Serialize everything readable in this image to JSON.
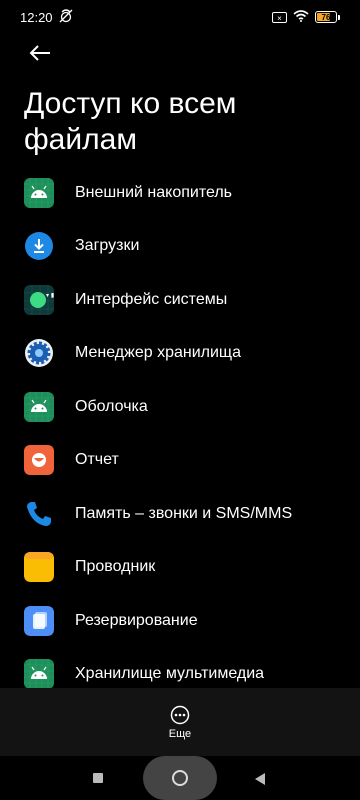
{
  "status_bar": {
    "time": "12:20",
    "battery_level": "76",
    "battery_fraction": 0.76,
    "battery_color": "#f5a623"
  },
  "page": {
    "title": "Доступ ко всем файлам"
  },
  "apps": [
    {
      "label": "Внешний накопитель",
      "icon": "android-icon"
    },
    {
      "label": "Загрузки",
      "icon": "download-icon"
    },
    {
      "label": "Интерфейс системы",
      "icon": "system-ui-icon"
    },
    {
      "label": "Менеджер хранилища",
      "icon": "storage-manager-icon"
    },
    {
      "label": "Оболочка",
      "icon": "android-icon"
    },
    {
      "label": "Отчет",
      "icon": "report-icon"
    },
    {
      "label": "Память – звонки и SMS/MMS",
      "icon": "phone-icon"
    },
    {
      "label": "Проводник",
      "icon": "folder-icon"
    },
    {
      "label": "Резервирование",
      "icon": "backup-icon"
    },
    {
      "label": "Хранилище мультимедиа",
      "icon": "android-icon"
    }
  ],
  "bottom_panel": {
    "more_label": "Еще"
  }
}
